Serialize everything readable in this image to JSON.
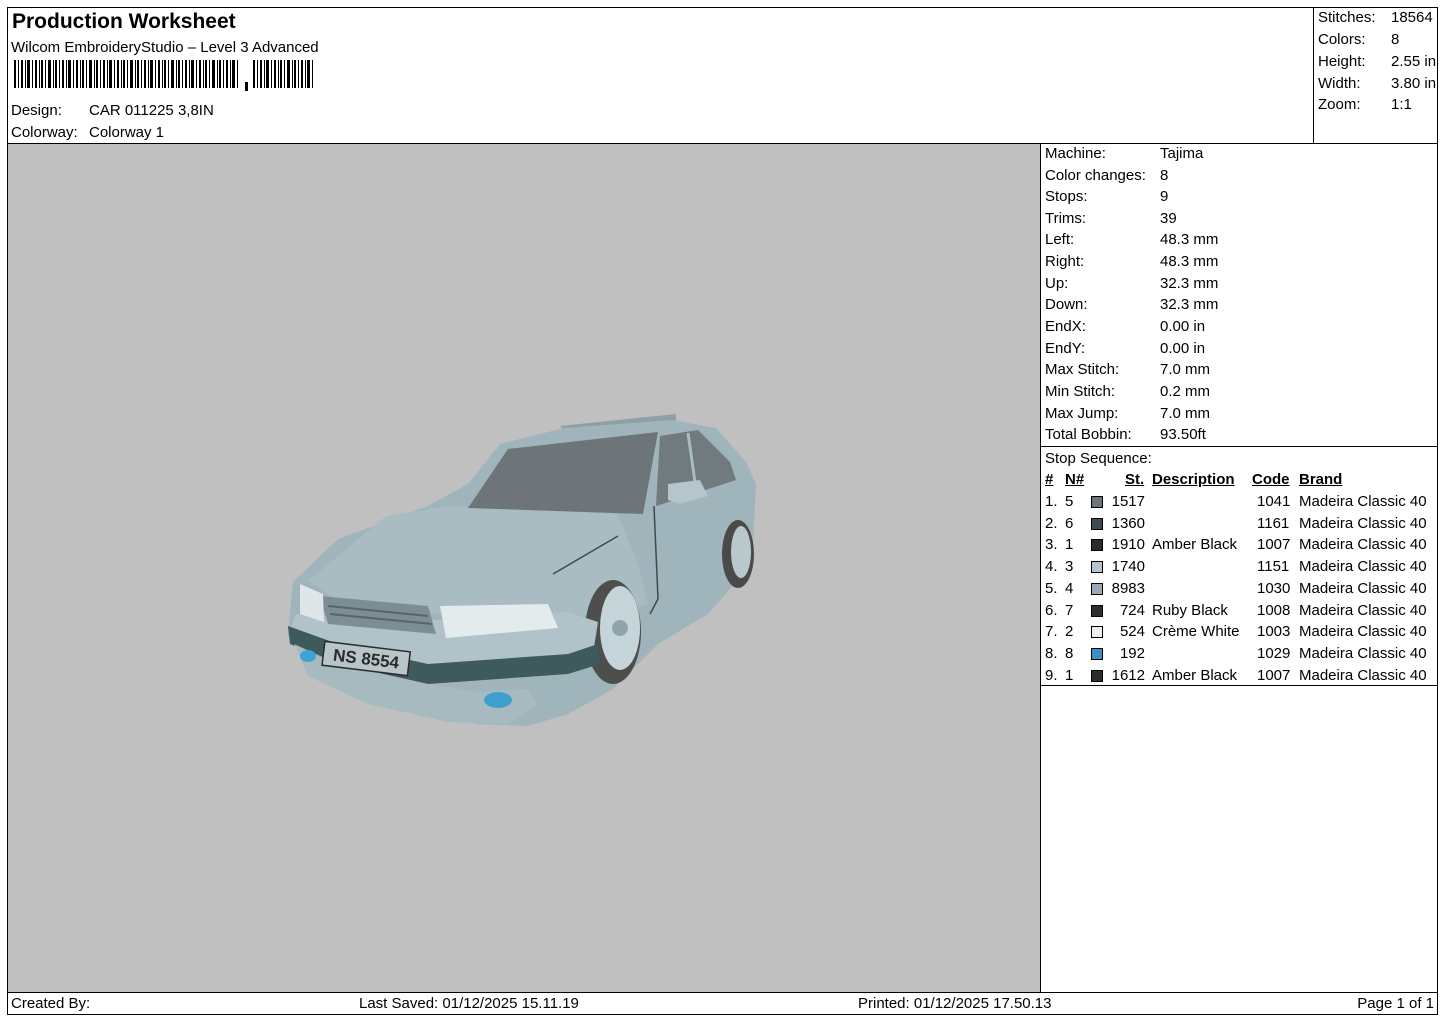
{
  "header": {
    "title": "Production Worksheet",
    "subtitle": "Wilcom EmbroideryStudio – Level 3 Advanced",
    "design_label": "Design:",
    "design_value": "CAR 011225 3,8IN",
    "colorway_label": "Colorway:",
    "colorway_value": "Colorway 1"
  },
  "stats": [
    {
      "label": "Stitches:",
      "value": "18564"
    },
    {
      "label": "Colors:",
      "value": "8"
    },
    {
      "label": "Height:",
      "value": "2.55 in"
    },
    {
      "label": "Width:",
      "value": "3.80 in"
    },
    {
      "label": "Zoom:",
      "value": "1:1"
    }
  ],
  "machine_info": [
    {
      "label": "Machine:",
      "value": "Tajima"
    },
    {
      "label": "Color changes:",
      "value": "8"
    },
    {
      "label": "Stops:",
      "value": "9"
    },
    {
      "label": "Trims:",
      "value": "39"
    },
    {
      "label": "Left:",
      "value": "48.3 mm"
    },
    {
      "label": "Right:",
      "value": "48.3 mm"
    },
    {
      "label": "Up:",
      "value": "32.3 mm"
    },
    {
      "label": "Down:",
      "value": "32.3 mm"
    },
    {
      "label": "EndX:",
      "value": "0.00 in"
    },
    {
      "label": "EndY:",
      "value": "0.00 in"
    },
    {
      "label": "Max Stitch:",
      "value": "7.0 mm"
    },
    {
      "label": "Min Stitch:",
      "value": "0.2 mm"
    },
    {
      "label": "Max Jump:",
      "value": "7.0 mm"
    },
    {
      "label": "Total Bobbin:",
      "value": "93.50ft"
    }
  ],
  "stop_sequence": {
    "caption": "Stop Sequence:",
    "headers": {
      "num": "#",
      "needle": "N#",
      "stitches": "St.",
      "description": "Description",
      "code": "Code",
      "brand": "Brand"
    },
    "rows": [
      {
        "num": "1.",
        "needle": "5",
        "color": "#6b7478",
        "stitches": "1517",
        "description": "",
        "code": "1041",
        "brand": "Madeira Classic 40"
      },
      {
        "num": "2.",
        "needle": "6",
        "color": "#3d4a50",
        "stitches": "1360",
        "description": "",
        "code": "1161",
        "brand": "Madeira Classic 40"
      },
      {
        "num": "3.",
        "needle": "1",
        "color": "#2b2b2b",
        "stitches": "1910",
        "description": "Amber Black",
        "code": "1007",
        "brand": "Madeira Classic 40"
      },
      {
        "num": "4.",
        "needle": "3",
        "color": "#b7c3cc",
        "stitches": "1740",
        "description": "",
        "code": "1151",
        "brand": "Madeira Classic 40"
      },
      {
        "num": "5.",
        "needle": "4",
        "color": "#9aa8b6",
        "stitches": "8983",
        "description": "",
        "code": "1030",
        "brand": "Madeira Classic 40"
      },
      {
        "num": "6.",
        "needle": "7",
        "color": "#2e2e2e",
        "stitches": "724",
        "description": "Ruby Black",
        "code": "1008",
        "brand": "Madeira Classic 40"
      },
      {
        "num": "7.",
        "needle": "2",
        "color": "#efefef",
        "stitches": "524",
        "description": "Crème White",
        "code": "1003",
        "brand": "Madeira Classic 40"
      },
      {
        "num": "8.",
        "needle": "8",
        "color": "#3e8fc8",
        "stitches": "192",
        "description": "",
        "code": "1029",
        "brand": "Madeira Classic 40"
      },
      {
        "num": "9.",
        "needle": "1",
        "color": "#2b2b2b",
        "stitches": "1612",
        "description": "Amber Black",
        "code": "1007",
        "brand": "Madeira Classic 40"
      }
    ]
  },
  "preview": {
    "plate_text": "NS 8554"
  },
  "footer": {
    "created_by": "Created By:",
    "last_saved": "Last Saved: 01/12/2025 15.11.19",
    "printed": "Printed: 01/12/2025 17.50.13",
    "page": "Page 1 of 1"
  }
}
